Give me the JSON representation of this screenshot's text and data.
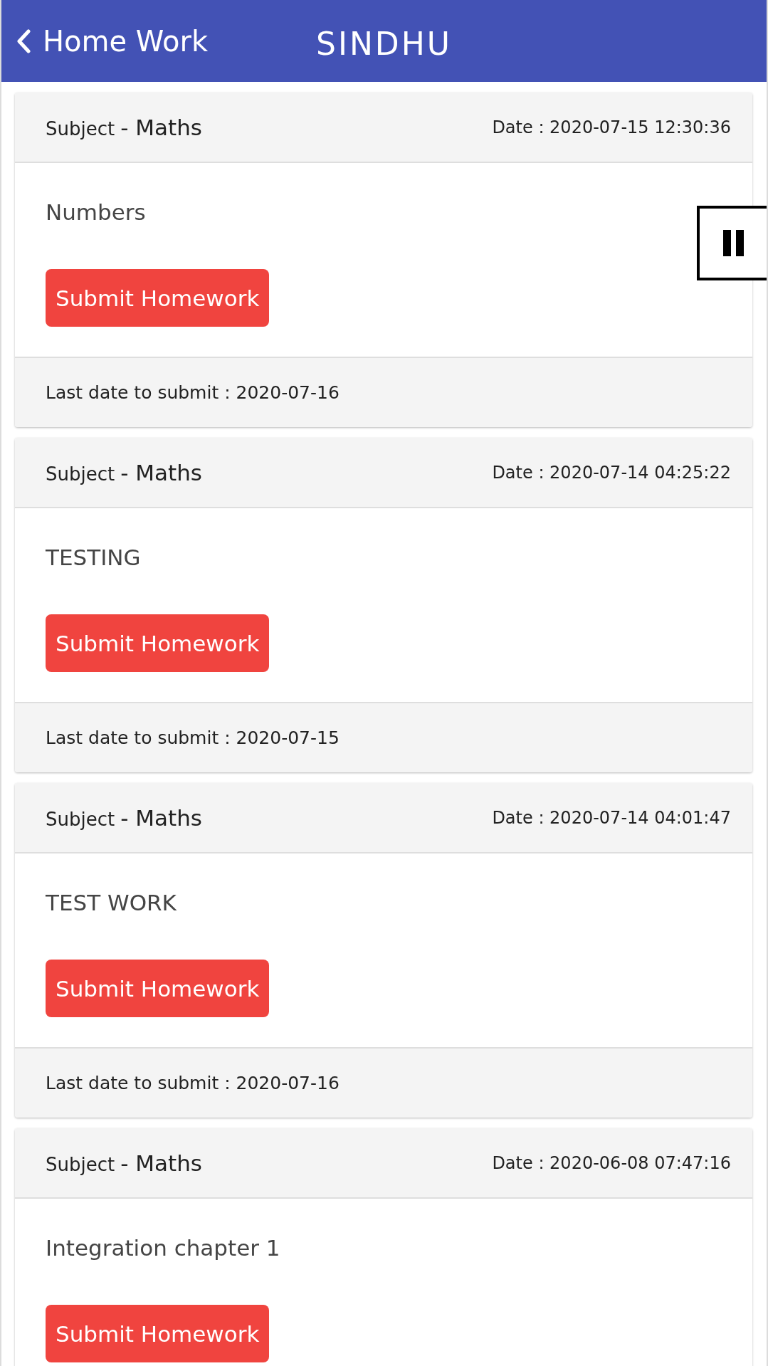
{
  "app_bar": {
    "back_label": "Home Work",
    "title": "SINDHU"
  },
  "homework": [
    {
      "subject_label": "Subject",
      "subject": "- Maths",
      "date": "Date : 2020-07-15 12:30:36",
      "title": "Numbers",
      "button": "Submit Homework",
      "last_date": "Last date to submit : 2020-07-16"
    },
    {
      "subject_label": "Subject",
      "subject": "- Maths",
      "date": "Date : 2020-07-14 04:25:22",
      "title": "TESTING",
      "button": "Submit Homework",
      "last_date": "Last date to submit : 2020-07-15"
    },
    {
      "subject_label": "Subject",
      "subject": "- Maths",
      "date": "Date : 2020-07-14 04:01:47",
      "title": "TEST WORK",
      "button": "Submit Homework",
      "last_date": "Last date to submit : 2020-07-16"
    },
    {
      "subject_label": "Subject",
      "subject": "- Maths",
      "date": "Date : 2020-06-08 07:47:16",
      "title": "Integration chapter 1",
      "button": "Submit Homework"
    }
  ]
}
